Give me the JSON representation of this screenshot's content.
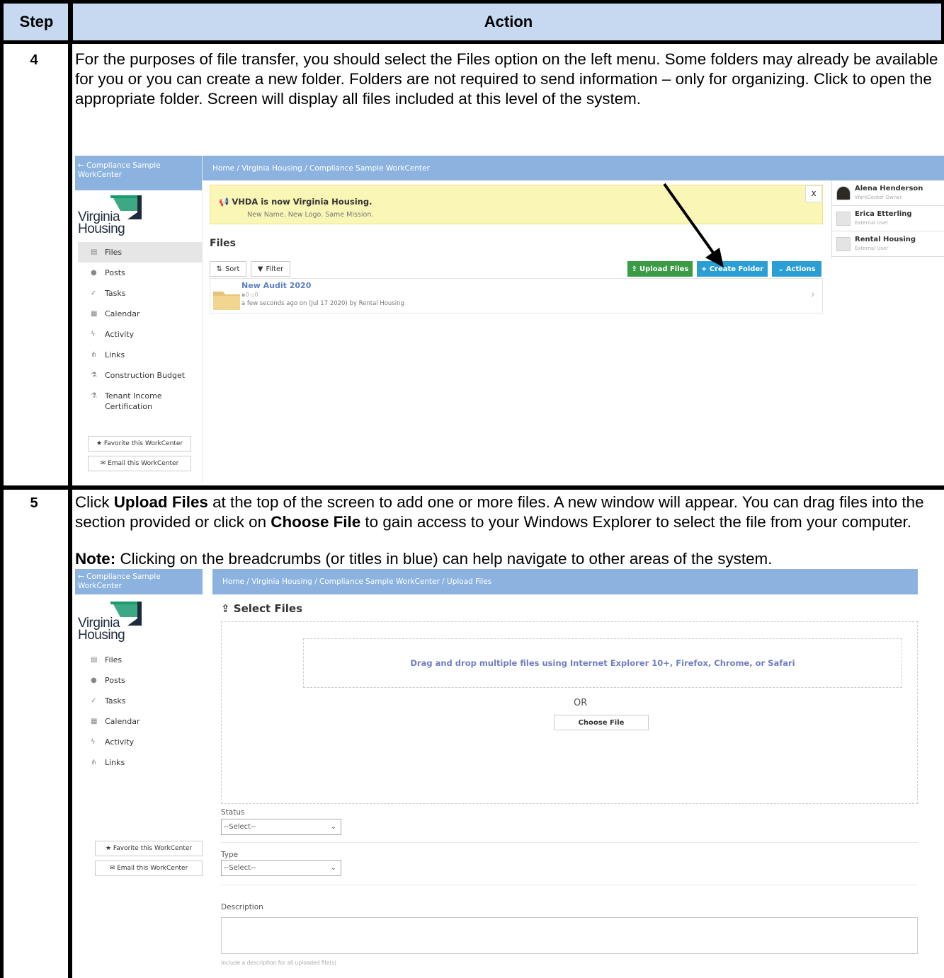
{
  "table": {
    "header_step": "Step",
    "header_action": "Action"
  },
  "step4": {
    "number": "4",
    "text": "For the purposes of file transfer, you should select the Files option on the left menu. Some folders may already be available for you or you can create a new folder. Folders are not required to send information – only for organizing. Click to open the appropriate folder. Screen will display all files included at this level of the system."
  },
  "step5": {
    "number": "5",
    "text_a": "Click ",
    "bold_upload": "Upload Files",
    "text_b": " at the top of the screen to add one or more files. A new window will appear. You can drag files into the section provided or click on ",
    "bold_choose": "Choose File",
    "text_c": " to gain access to your Windows Explorer to select the file from your computer.",
    "note_label": "Note:",
    "note_text": "  Clicking on the breadcrumbs (or titles in blue) can help navigate to other areas of the system."
  },
  "screen1": {
    "back_link": "← Compliance Sample WorkCenter",
    "logo_line1": "Virginia",
    "logo_line2": "Housing",
    "breadcrumb": "Home  /  Virginia Housing  /  Compliance Sample WorkCenter",
    "nav": [
      {
        "icon": "▤",
        "label": "Files"
      },
      {
        "icon": "●",
        "label": "Posts"
      },
      {
        "icon": "✓",
        "label": "Tasks"
      },
      {
        "icon": "▦",
        "label": "Calendar"
      },
      {
        "icon": "ϟ",
        "label": "Activity"
      },
      {
        "icon": "⋔",
        "label": "Links"
      },
      {
        "icon": "⚗",
        "label": "Construction Budget"
      },
      {
        "icon": "⚗",
        "label": "Tenant Income Certification"
      }
    ],
    "favorite_btn": "★ Favorite this WorkCenter",
    "email_btn": "✉ Email this WorkCenter",
    "alert_title": "VHDA is now Virginia Housing.",
    "alert_sub": "New Name. New Logo. Same Mission.",
    "alert_close": "X",
    "files_heading": "Files",
    "sort_btn": "Sort",
    "filter_btn": "Filter",
    "upload_btn": "Upload Files",
    "create_folder_btn": "+ Create Folder",
    "actions_btn": "Actions",
    "folder_name": "New Audit 2020",
    "folder_counts": "▪0   ▫0",
    "folder_meta": "a few seconds ago on (Jul 17 2020) by Rental Housing",
    "users": [
      {
        "name": "Alena Henderson",
        "role": "WorkCenter Owner"
      },
      {
        "name": "Erica Etterling",
        "role": "External User"
      },
      {
        "name": "Rental Housing",
        "role": "External User"
      }
    ],
    "colors": {
      "green": "#3c9b46",
      "blue": "#2a9fd6",
      "bar": "#8cb3e0"
    }
  },
  "screen2": {
    "back_link": "← Compliance Sample WorkCenter",
    "logo_line1": "Virginia",
    "logo_line2": "Housing",
    "breadcrumb": "Home  /  Virginia Housing  /  Compliance Sample WorkCenter  /  Upload Files",
    "nav": [
      {
        "icon": "▤",
        "label": "Files"
      },
      {
        "icon": "●",
        "label": "Posts"
      },
      {
        "icon": "✓",
        "label": "Tasks"
      },
      {
        "icon": "▦",
        "label": "Calendar"
      },
      {
        "icon": "ϟ",
        "label": "Activity"
      },
      {
        "icon": "⋔",
        "label": "Links"
      }
    ],
    "favorite_btn": "★ Favorite this WorkCenter",
    "email_btn": "✉ Email this WorkCenter",
    "select_files": "Select Files",
    "drop_text": "Drag and drop multiple files using Internet Explorer 10+, Firefox, Chrome, or Safari",
    "or_text": "OR",
    "choose_file": "Choose File",
    "status_label": "Status",
    "status_value": "--Select--",
    "type_label": "Type",
    "type_value": "--Select--",
    "description_label": "Description",
    "description_hint": "Include a description for all uploaded file(s)"
  }
}
